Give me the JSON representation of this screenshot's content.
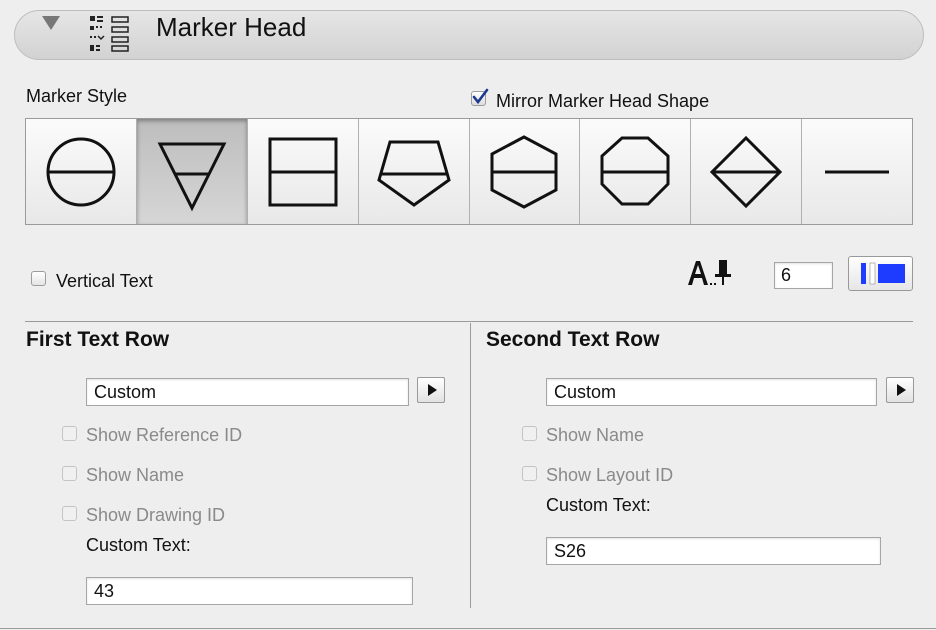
{
  "header": {
    "title": "Marker Head"
  },
  "marker_style": {
    "label": "Marker Style",
    "mirror_label": "Mirror Marker Head Shape",
    "mirror_checked": true,
    "shapes": [
      "circle",
      "triangle",
      "rectangle",
      "pentagon",
      "hexagon",
      "octagon",
      "diamond",
      "line"
    ],
    "selected": "triangle"
  },
  "vertical_text": {
    "label": "Vertical Text",
    "checked": false
  },
  "font_size": {
    "value": "6"
  },
  "first_row": {
    "title": "First Text Row",
    "dropdown_value": "Custom",
    "show_reference_id": "Show Reference ID",
    "show_name": "Show Name",
    "show_drawing_id": "Show Drawing ID",
    "custom_text_label": "Custom Text:",
    "custom_text_value": "43"
  },
  "second_row": {
    "title": "Second Text Row",
    "dropdown_value": "Custom",
    "show_name": "Show Name",
    "show_layout_id": "Show Layout ID",
    "custom_text_label": "Custom Text:",
    "custom_text_value": "S26"
  },
  "colors": {
    "accent_blue": "#1e3cff",
    "checkmark": "#1c3a8f"
  }
}
